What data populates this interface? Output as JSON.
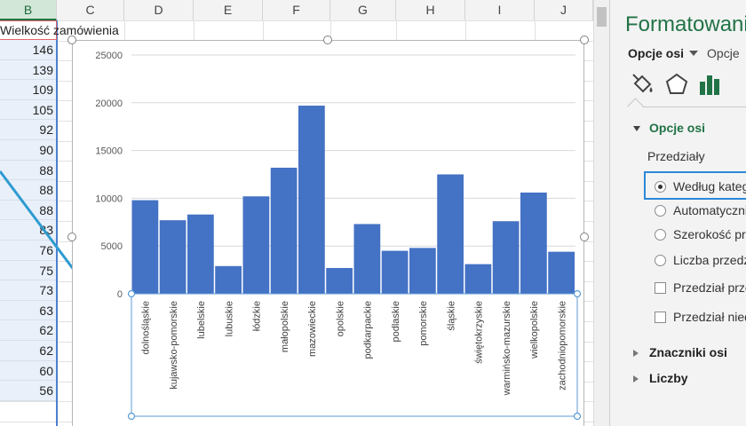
{
  "sheet": {
    "columns": [
      "B",
      "C",
      "D",
      "E",
      "F",
      "G",
      "H",
      "I",
      "J"
    ],
    "header_text": "Wielkość zamówienia",
    "values": [
      "146",
      "139",
      "109",
      "105",
      "92",
      "90",
      "88",
      "88",
      "88",
      "83",
      "76",
      "75",
      "73",
      "63",
      "62",
      "62",
      "60",
      "56"
    ]
  },
  "pane": {
    "title": "Formatowanie",
    "tab_active": "Opcje osi",
    "tab_other": "Opcje",
    "section_axis": "Opcje osi",
    "przedzialy_label": "Przedziały",
    "options": [
      {
        "label": "Według kategorii",
        "kind": "radio",
        "checked": true
      },
      {
        "label": "Automatycznie",
        "kind": "radio",
        "checked": false
      },
      {
        "label": "Szerokość przedziału",
        "kind": "radio",
        "checked": false
      },
      {
        "label": "Liczba przedziałów",
        "kind": "radio",
        "checked": false
      },
      {
        "label": "Przedział przepełnienia",
        "kind": "check",
        "checked": false
      },
      {
        "label": "Przedział niedopełnienia",
        "kind": "check",
        "checked": false
      }
    ],
    "section_znaczniki": "Znaczniki osi",
    "section_liczby": "Liczby",
    "icons": [
      "fill-bucket-icon",
      "pentagon-effects-icon",
      "bar-chart-options-icon"
    ]
  },
  "colors": {
    "bar": "#4472c4",
    "accent_green": "#217346",
    "arrow": "#2e9bd0",
    "selection_blue": "#2b88d8"
  },
  "chart_data": {
    "type": "bar",
    "categories": [
      "dolnośląskie",
      "kujawsko-pomorskie",
      "lubelskie",
      "lubuskie",
      "łódzkie",
      "małopolskie",
      "mazowieckie",
      "opolskie",
      "podkarpackie",
      "podlaskie",
      "pomorskie",
      "śląskie",
      "świętokrzyskie",
      "warmińsko-mazurskie",
      "wielkopolskie",
      "zachodniopomorskie"
    ],
    "values": [
      9800,
      7700,
      8300,
      2900,
      10200,
      13200,
      19700,
      2700,
      7300,
      4500,
      4800,
      12500,
      3100,
      7600,
      10600,
      4400
    ],
    "yticks": [
      0,
      5000,
      10000,
      15000,
      20000,
      25000
    ],
    "ylim": [
      0,
      25000
    ],
    "grid": true,
    "title": "",
    "xlabel": "",
    "ylabel": ""
  }
}
